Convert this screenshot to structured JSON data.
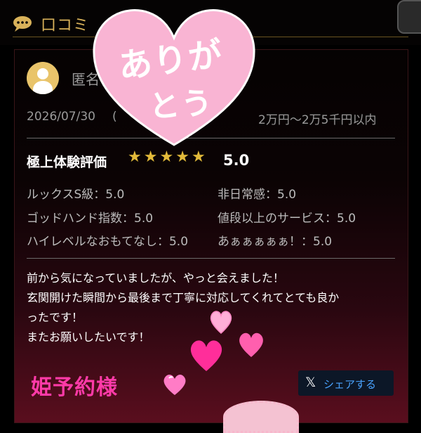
{
  "header": {
    "title": "口コミ",
    "icon": "speech-bubble-icon"
  },
  "reviewer": {
    "name": "匿名"
  },
  "meta": {
    "date": "2026/07/30",
    "date_suffix": "(",
    "price": "2万円〜2万5千円以内"
  },
  "rating": {
    "label": "極上体験評価",
    "stars": 5,
    "value": "5.0"
  },
  "attributes": [
    {
      "text": "ルックスS級：5.0"
    },
    {
      "text": "非日常感：5.0"
    },
    {
      "text": "ゴッドハンド指数：5.0"
    },
    {
      "text": "値段以上のサービス：5.0"
    },
    {
      "text": "ハイレベルなおもてなし：5.0"
    },
    {
      "text": "あぁぁぁぁぁ！：5.0"
    }
  ],
  "review_lines": [
    "前から気になっていましたが、やっと会えました！",
    "玄関開けた瞬間から最後まで丁寧に対応してくれてとても良か",
    "ったです！",
    "またお願いしたいです！"
  ],
  "sticker": {
    "line1": "ありが",
    "line2": "とう",
    "bottom_label": "姫予約様"
  },
  "share": {
    "label": "シェアする",
    "icon": "x-logo-icon"
  },
  "colors": {
    "gold": "#d9b25a",
    "star": "#e2ba3a",
    "pink": "#ff3aa8",
    "sticker_heart": "#f9b4d3",
    "share_text": "#4aa3ff"
  }
}
